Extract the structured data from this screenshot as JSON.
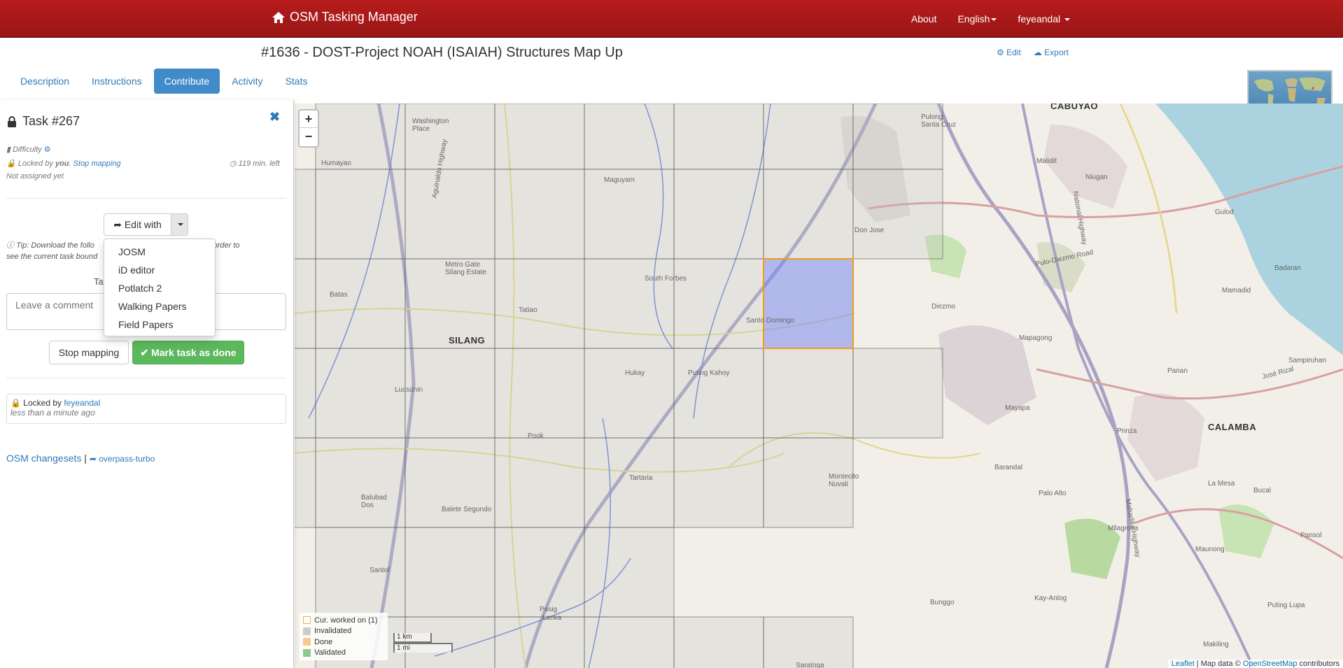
{
  "navbar": {
    "brand": "OSM Tasking Manager",
    "about": "About",
    "language": "English",
    "user": "feyeandal"
  },
  "project": {
    "title": "#1636 - DOST-Project NOAH (ISAIAH) Structures Map Up",
    "edit_label": "Edit",
    "export_label": "Export"
  },
  "tabs": [
    "Description",
    "Instructions",
    "Contribute",
    "Activity",
    "Stats"
  ],
  "task": {
    "title": "Task #267",
    "difficulty": "Difficulty",
    "locked_by_prefix": "Locked by",
    "locked_by_you": "you",
    "stop_mapping_link": "Stop mapping",
    "time_left": "119 min. left",
    "assigned": "Not assigned yet",
    "edit_with": "Edit with",
    "tip": "Tip: Download the following file and add it as a layer in JOSM in order to see the current task boundary",
    "tip_visible_start": "Tip: Download the follo",
    "tip_visible_end": "OSM in order to",
    "tip_line2_start": "see the current task bound",
    "comment_label": "Ta",
    "comment_placeholder": "Leave a comment",
    "stop_mapping_button": "Stop mapping",
    "mark_done_button": "Mark task as done",
    "history": {
      "locked_by": "Locked by",
      "user": "feyeandal",
      "when": "less than a minute ago"
    },
    "osm_changesets": "OSM changesets",
    "separator": "|",
    "overpass": "overpass-turbo"
  },
  "editors_menu": [
    "JOSM",
    "iD editor",
    "Potlatch 2",
    "Walking Papers",
    "Field Papers"
  ],
  "map": {
    "zoom_in": "+",
    "zoom_out": "−",
    "legend": [
      {
        "label": "Cur. worked on (1)",
        "color": "#ffffff",
        "border": "#f0ad4e"
      },
      {
        "label": "Invalidated",
        "color": "#cccccc",
        "border": "#cccccc"
      },
      {
        "label": "Done",
        "color": "#f8c98a",
        "border": "#f8c98a"
      },
      {
        "label": "Validated",
        "color": "#8fc98f",
        "border": "#8fc98f"
      }
    ],
    "scale_km": "1 km",
    "scale_mi": "1 mi",
    "attribution_leaflet": "Leaflet",
    "attribution_text": " | Map data © ",
    "attribution_osm": "OpenStreetMap",
    "attribution_tail": " contributors",
    "places": {
      "cabuyao": "CABUYAO",
      "silang": "SILANG",
      "calamba": "CALAMBA",
      "washington": "Washington Place",
      "humayao": "Humayao",
      "maguyam": "Maguyam",
      "pulong": "Pulong Santa Cruz",
      "malidit": "Malidit",
      "niugan": "Niugan",
      "gulod": "Gulod",
      "don_jose": "Don Jose",
      "pulo": "Pulo-Diezmo Road",
      "mamadid": "Mamadid",
      "badaran": "Badaran",
      "diezmo": "Diezmo",
      "south_forbes": "South Forbes",
      "metro_gate": "Metro Gate Silang Estate",
      "batas": "Batas",
      "tatiao": "Tatiao",
      "santo_domingo": "Santo Domingo",
      "hukay": "Hukay",
      "puting": "Puting Kahoy",
      "lucsuhin": "Lucsuhin",
      "mapagong": "Mapagong",
      "parian": "Parian",
      "jose_rizal": "José Rizal",
      "mayapa": "Mayapa",
      "prinza": "Prinza",
      "barandal": "Barandal",
      "la_mesa": "La Mesa",
      "bucal": "Bucal",
      "pook": "Pook",
      "tartaria": "Tartaria",
      "montecito": "Montecito Nuvali",
      "palo_alto": "Palo Alto",
      "milagrosa": "Milagrosa",
      "balubad": "Balubad Dos",
      "balete": "Balete Segundo",
      "maunong": "Maunong",
      "pansol": "Pansol",
      "santol": "Santol",
      "kay_anlog": "Kay-Anlog",
      "bunggo": "Bunggo",
      "puting_lupa": "Puting Lupa",
      "makiling": "Makiling",
      "lanka": "Lanka",
      "sampiruhan": "Sampiruhan",
      "national_highway": "National Highway",
      "aguinaldo": "Aguinaldo Highway",
      "maharlika": "Maharlika Highway",
      "saratoga": "Saratoga",
      "pasig": "Pasig"
    }
  }
}
